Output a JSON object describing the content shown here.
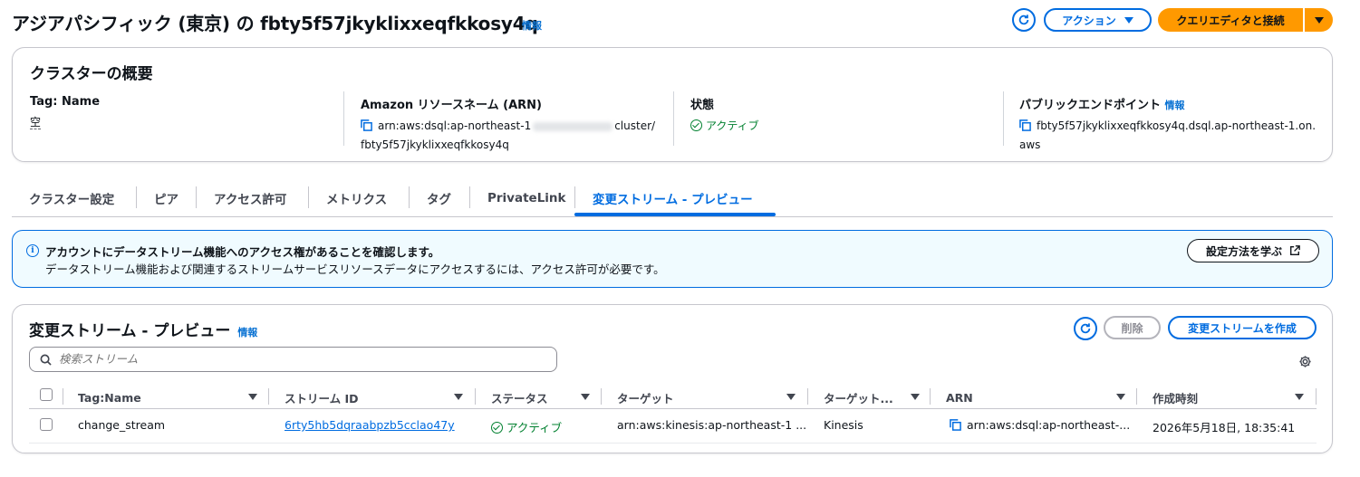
{
  "header": {
    "title": "アジアパシフィック (東京) の fbty5f57jkyklixxeqfkkosy4q",
    "info_label": "情報",
    "actions_label": "アクション",
    "connect_label": "クエリエディタと接続"
  },
  "overview": {
    "title": "クラスターの概要",
    "tag_label": "Tag: Name",
    "tag_value": "空",
    "arn_label": "Amazon リソースネーム (ARN)",
    "arn_line1_prefix": "arn:aws:dsql:ap-northeast-1",
    "arn_line1_suffix": "cluster/",
    "arn_line2": "fbty5f57jkyklixxeqfkkosy4q",
    "status_label": "状態",
    "status_value": "アクティブ",
    "endpoint_label": "パブリックエンドポイント",
    "endpoint_info": "情報",
    "endpoint_line1": "fbty5f57jkyklixxeqfkkosy4q.dsql.ap-northeast-1.on.",
    "endpoint_line2": "aws"
  },
  "tabs": [
    {
      "label": "クラスター設定"
    },
    {
      "label": "ピア"
    },
    {
      "label": "アクセス許可"
    },
    {
      "label": "メトリクス"
    },
    {
      "label": "タグ"
    },
    {
      "label": "PrivateLink"
    },
    {
      "label": "変更ストリーム - プレビュー"
    }
  ],
  "active_tab": "変更ストリーム - プレビュー",
  "alert": {
    "title": "アカウントにデータストリーム機能へのアクセス権があることを確認します。",
    "body": "データストリーム機能および関連するストリームサービスリソースデータにアクセスするには、アクセス許可が必要です。",
    "button_label": "設定方法を学ぶ"
  },
  "streams": {
    "title": "変更ストリーム - プレビュー",
    "info_label": "情報",
    "delete_label": "削除",
    "create_label": "変更ストリームを作成",
    "search_placeholder": "検索ストリーム",
    "columns": [
      "Tag:Name",
      "ストリーム ID",
      "ステータス",
      "ターゲット",
      "ターゲット...",
      "ARN",
      "作成時刻"
    ],
    "rows": [
      {
        "tag_name": "change_stream",
        "stream_id": "6rty5hb5dqraabpzb5cclao47y",
        "status": "アクティブ",
        "target": "arn:aws:kinesis:ap-northeast-1 ...",
        "target_type": "Kinesis",
        "arn": "arn:aws:dsql:ap-northeast-...",
        "created": "2026年5月18日, 18:35:41"
      }
    ]
  },
  "colors": {
    "accent": "#006ce0",
    "primary_button": "#ff9900",
    "success": "#00802f",
    "info_bg": "#f0fbff"
  }
}
